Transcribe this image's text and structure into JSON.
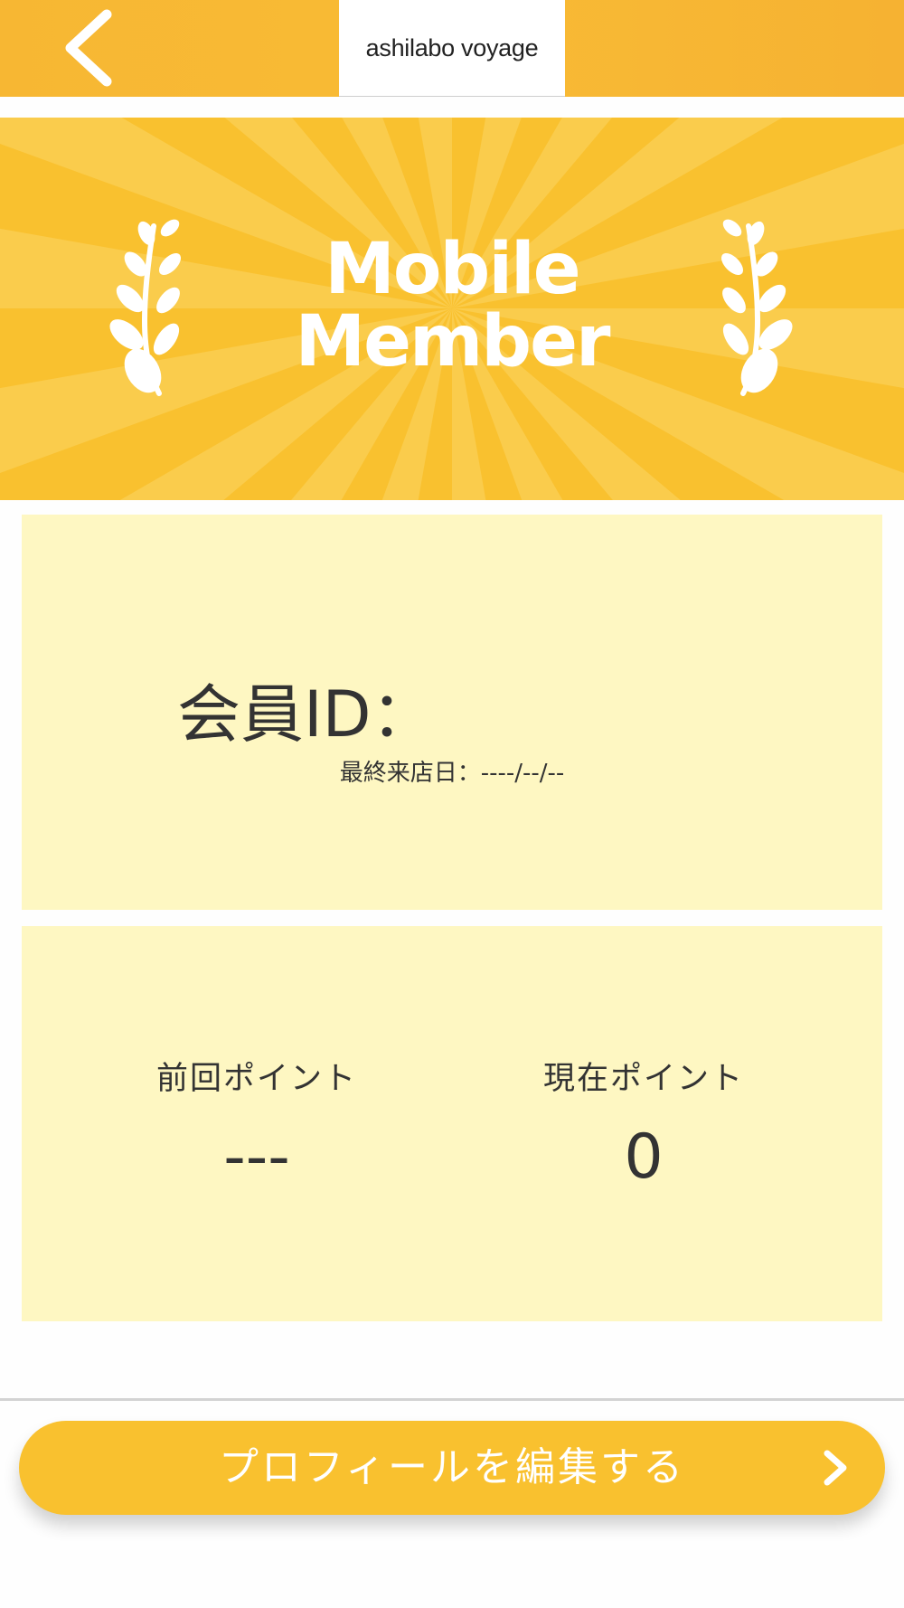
{
  "header": {
    "back_icon": "chevron-left-icon",
    "title": "ashilabo voyage"
  },
  "banner": {
    "title_line1": "Mobile",
    "title_line2": "Member",
    "decoration_icon": "laurel-icon"
  },
  "member_card": {
    "member_id_label": "会員ID：",
    "last_visit": "最終来店日：----/--/--"
  },
  "points_card": {
    "previous_label": "前回ポイント",
    "previous_value": "---",
    "current_label": "現在ポイント",
    "current_value": "0"
  },
  "footer": {
    "edit_profile_label": "プロフィールを編集する",
    "arrow_icon": "chevron-right-icon"
  },
  "colors": {
    "header": "#f7b733",
    "banner": "#f9c12f",
    "card": "#fef7c2",
    "button": "#f9c12f"
  }
}
